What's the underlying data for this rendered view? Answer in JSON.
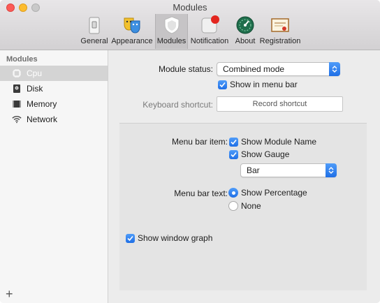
{
  "window": {
    "title": "Modules"
  },
  "toolbar": {
    "items": [
      {
        "label": "General",
        "icon": "switch-icon"
      },
      {
        "label": "Appearance",
        "icon": "theater-masks-icon"
      },
      {
        "label": "Modules",
        "icon": "shield-icon",
        "active": true
      },
      {
        "label": "Notification",
        "icon": "notification-badge-icon"
      },
      {
        "label": "About",
        "icon": "gauge-icon"
      },
      {
        "label": "Registration",
        "icon": "certificate-icon"
      }
    ]
  },
  "sidebar": {
    "header": "Modules",
    "items": [
      {
        "label": "Cpu",
        "icon": "cpu-chip-icon",
        "selected": true
      },
      {
        "label": "Disk",
        "icon": "disk-icon"
      },
      {
        "label": "Memory",
        "icon": "memory-icon"
      },
      {
        "label": "Network",
        "icon": "wifi-icon"
      }
    ],
    "add_label": "+"
  },
  "settings": {
    "module_status_label": "Module status:",
    "module_status_value": "Combined mode",
    "show_in_menu_bar": "Show in menu bar",
    "keyboard_shortcut_label": "Keyboard shortcut:",
    "record_shortcut": "Record shortcut",
    "menu_bar_item_label": "Menu bar item:",
    "show_module_name": "Show Module Name",
    "show_gauge": "Show Gauge",
    "gauge_type_value": "Bar",
    "menu_bar_text_label": "Menu bar text:",
    "show_percentage": "Show Percentage",
    "none": "None",
    "show_window_graph": "Show window graph"
  },
  "colors": {
    "accent": "#1f6fe6",
    "selection": "#d4d4d4"
  }
}
